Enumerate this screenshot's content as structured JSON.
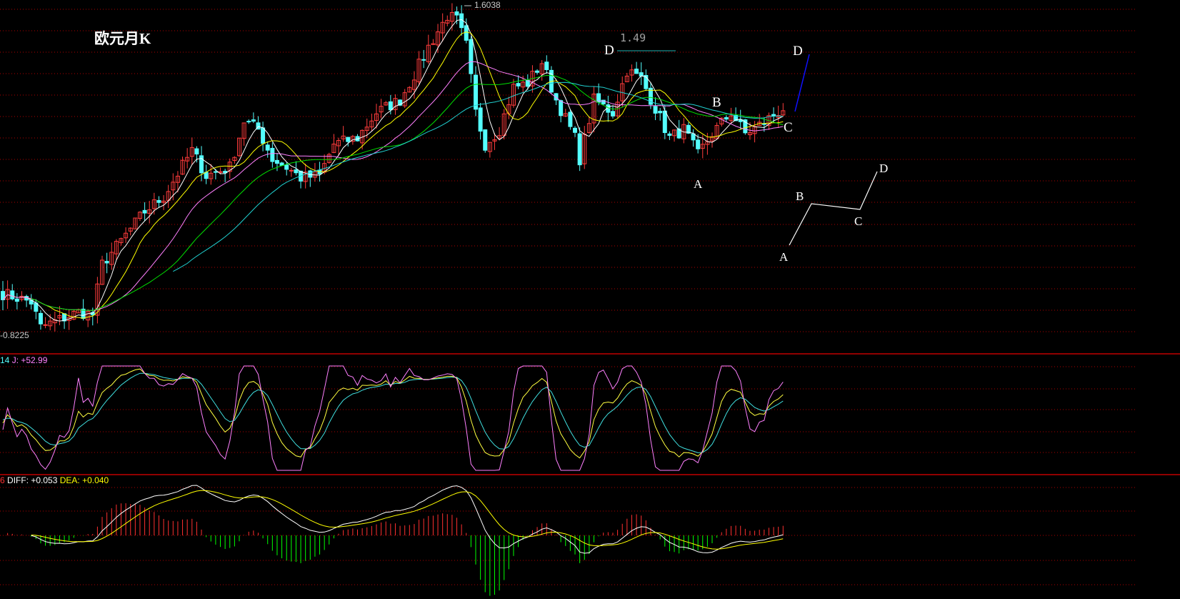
{
  "title": "欧元月K",
  "price_high_label": "1.6038",
  "price_low_label": "-0.8225",
  "level_label": "1.49",
  "kdj_label": {
    "prefix": "14",
    "j": "J: +52.99"
  },
  "macd_label": {
    "prefix": "6",
    "diff": "DIFF: +0.053",
    "dea": "DEA: +0.040"
  },
  "wave_labels_chart": {
    "d1": "D",
    "b": "B",
    "c": "C",
    "a": "A",
    "d2": "D"
  },
  "wave_labels_diagram": {
    "a": "A",
    "b": "B",
    "c": "C",
    "d": "D"
  },
  "colors": {
    "up": "#ff3c3c",
    "down": "#54ffff",
    "grid": "#b00000",
    "ma": [
      "#ffffff",
      "#ffff00",
      "#ff80ff",
      "#00e000",
      "#20d0d0"
    ]
  },
  "chart_data": {
    "type": "candlestick",
    "title": "欧元月K",
    "ylim": [
      0.8225,
      1.6038
    ],
    "count": 166,
    "close_anchors": [
      [
        0,
        0.92
      ],
      [
        6,
        0.9
      ],
      [
        8,
        0.84
      ],
      [
        16,
        0.876
      ],
      [
        19,
        0.87
      ],
      [
        21,
        0.99
      ],
      [
        25,
        1.045
      ],
      [
        30,
        1.115
      ],
      [
        34,
        1.15
      ],
      [
        40,
        1.26
      ],
      [
        43,
        1.2
      ],
      [
        48,
        1.22
      ],
      [
        51,
        1.33
      ],
      [
        54,
        1.31
      ],
      [
        57,
        1.24
      ],
      [
        60,
        1.22
      ],
      [
        63,
        1.195
      ],
      [
        67,
        1.2
      ],
      [
        70,
        1.275
      ],
      [
        75,
        1.29
      ],
      [
        79,
        1.35
      ],
      [
        84,
        1.38
      ],
      [
        87,
        1.44
      ],
      [
        90,
        1.506
      ],
      [
        94,
        1.58
      ],
      [
        96,
        1.57
      ],
      [
        98,
        1.51
      ],
      [
        100,
        1.35
      ],
      [
        102,
        1.275
      ],
      [
        105,
        1.31
      ],
      [
        108,
        1.41
      ],
      [
        111,
        1.42
      ],
      [
        114,
        1.47
      ],
      [
        117,
        1.38
      ],
      [
        121,
        1.29
      ],
      [
        122,
        1.24
      ],
      [
        125,
        1.38
      ],
      [
        129,
        1.35
      ],
      [
        132,
        1.45
      ],
      [
        135,
        1.43
      ],
      [
        138,
        1.36
      ],
      [
        141,
        1.29
      ],
      [
        144,
        1.31
      ],
      [
        147,
        1.25
      ],
      [
        150,
        1.3
      ],
      [
        154,
        1.35
      ],
      [
        157,
        1.3
      ],
      [
        160,
        1.32
      ],
      [
        165,
        1.36
      ]
    ],
    "ma_periods": [
      5,
      10,
      20,
      30,
      40
    ],
    "kdj": {
      "n": 9,
      "j_last": 52.99
    },
    "macd": {
      "fast": 12,
      "slow": 26,
      "signal": 9,
      "diff_last": 0.053,
      "dea_last": 0.04
    }
  }
}
